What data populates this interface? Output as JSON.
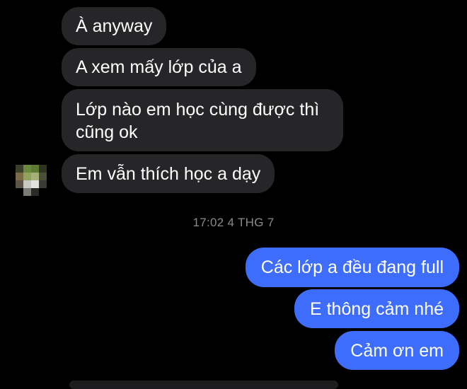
{
  "conversation": {
    "incoming": [
      {
        "text": "À anyway"
      },
      {
        "text": "A xem mấy lớp của a"
      },
      {
        "text": "Lớp nào em học cùng được thì cũng ok"
      },
      {
        "text": "Em vẫn thích học a dạy"
      }
    ],
    "timestamp": "17:02 4 THG 7",
    "outgoing": [
      {
        "text": "Các lớp a đều đang full"
      },
      {
        "text": "E thông cảm nhé"
      },
      {
        "text": "Cảm ơn em"
      }
    ]
  },
  "colors": {
    "background": "#000000",
    "incoming_bubble": "#262629",
    "outgoing_bubble": "#3e6dfb",
    "timestamp_text": "#8a8a8e"
  },
  "avatar": {
    "icon": "pixelated-avatar-icon"
  }
}
